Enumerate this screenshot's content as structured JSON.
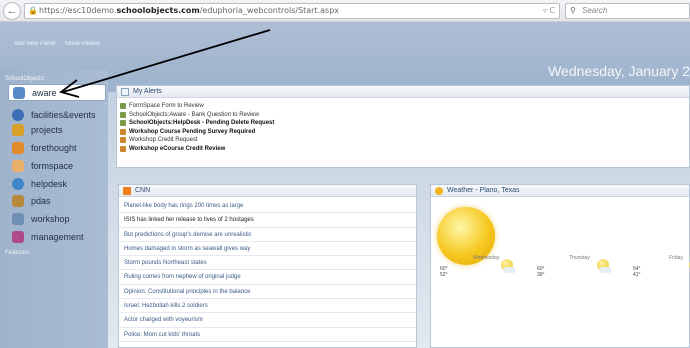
{
  "browser": {
    "url_prefix": "https://esc10demo.",
    "url_domain": "schoolobjects.com",
    "url_path": "/eduphoria_webcontrols/Start.aspx",
    "search_placeholder": "Search"
  },
  "toolbar": {
    "add_new_panel": "Add New Panel",
    "move_panels": "Move Panels"
  },
  "header": {
    "date": "Wednesday, January 2"
  },
  "sidebar": {
    "section_label": "SchoolObjects:",
    "features_label": "Features:",
    "items": [
      {
        "label": "aware",
        "icon": "magnifier-icon",
        "color": "#5a8ac8",
        "active": true
      },
      {
        "label": "facilities&events",
        "icon": "chevron-circle-icon",
        "color": "#3b6fb5"
      },
      {
        "label": "projects",
        "icon": "projects-icon",
        "color": "#d9a12a"
      },
      {
        "label": "forethought",
        "icon": "forethought-icon",
        "color": "#e08a2a"
      },
      {
        "label": "formspace",
        "icon": "formspace-icon",
        "color": "#e8b26a"
      },
      {
        "label": "helpdesk",
        "icon": "helpdesk-icon",
        "color": "#3c86c9"
      },
      {
        "label": "pdas",
        "icon": "pdas-icon",
        "color": "#b8893c"
      },
      {
        "label": "workshop",
        "icon": "workshop-icon",
        "color": "#6f8fb4"
      },
      {
        "label": "management",
        "icon": "management-icon",
        "color": "#b04a8a"
      }
    ]
  },
  "alerts": {
    "title": "My Alerts",
    "items": [
      {
        "text": "FormSpace Form to Review",
        "bold": false
      },
      {
        "text": "SchoolObjects:Aware - Bank Question to Review",
        "bold": false
      },
      {
        "text": "SchoolObjects:HelpDesk - Pending Delete Request",
        "bold": true
      },
      {
        "text": "Workshop Course Pending Survey Required",
        "bold": true
      },
      {
        "text": "Workshop Credit Request",
        "bold": false
      },
      {
        "text": "Workshop eCourse Credit Review",
        "bold": true
      }
    ]
  },
  "news": {
    "title": "CNN",
    "items": [
      "Planet-like body has rings 200 times as large",
      "ISIS has linked her release to lives of 2 hostages",
      "But predictions of group's demise are unrealistic",
      "Homes damaged in storm as seawall gives way",
      "Storm pounds Northeast states",
      "Ruling comes from nephew of original judge",
      "Opinion: Constitutional principles in the balance",
      "Israel: Hezbollah kills 2 soldiers",
      "Actor charged with voyeurism",
      "Police: Mom cut kids' throats"
    ]
  },
  "weather": {
    "title": "Weather - Plano, Texas",
    "days": [
      {
        "name": "Wednesday",
        "high": "60°",
        "low": "52°"
      },
      {
        "name": "Thursday",
        "high": "60°",
        "low": "39°"
      },
      {
        "name": "Friday",
        "high": "54°",
        "low": "41°"
      }
    ]
  }
}
